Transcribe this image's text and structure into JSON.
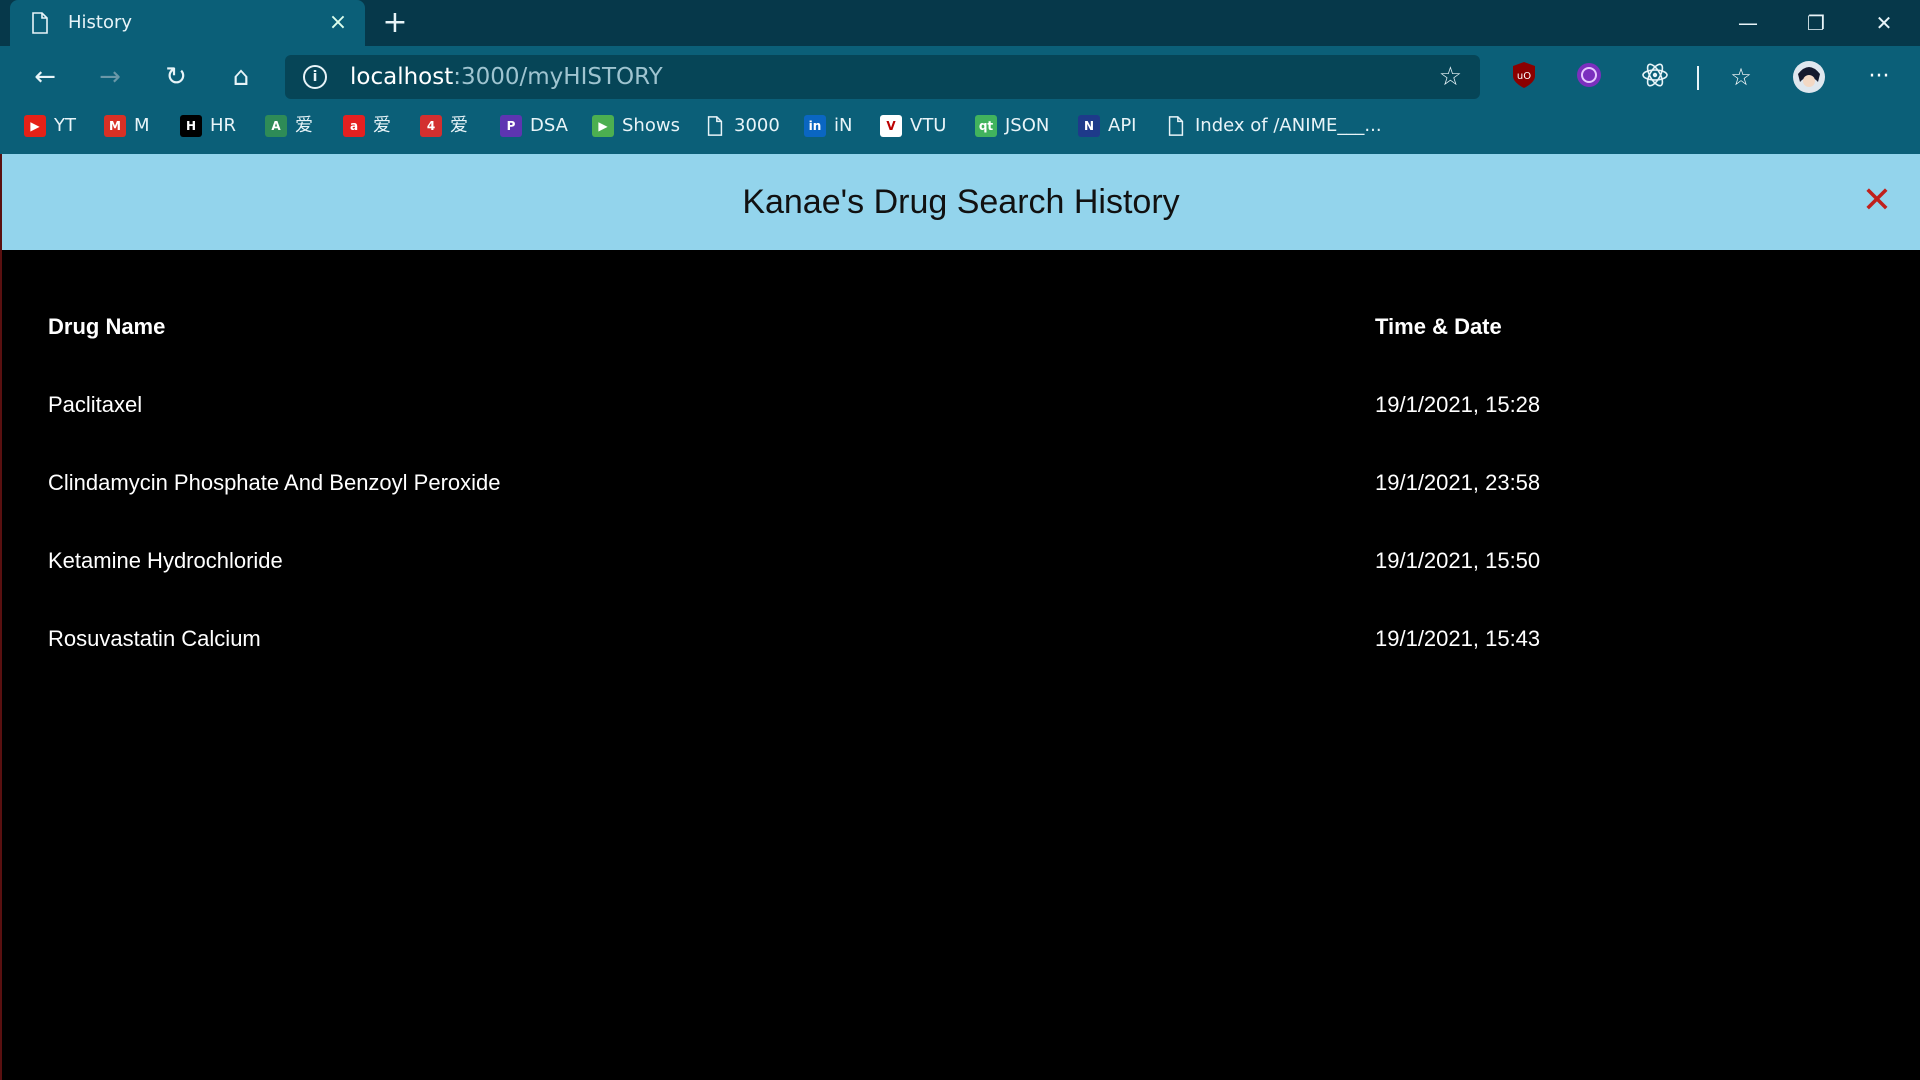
{
  "browser": {
    "tab_title": "History",
    "url_host": "localhost",
    "url_path": ":3000/myHISTORY",
    "bookmarks": [
      {
        "label": "YT",
        "icon": "youtube-icon",
        "color": "#e62117",
        "glyph": "▶"
      },
      {
        "label": "M",
        "icon": "gmail-icon",
        "color": "#d93025",
        "glyph": "M"
      },
      {
        "label": "HR",
        "icon": "hackerrank-icon",
        "color": "#000000",
        "glyph": "H"
      },
      {
        "label": "爱",
        "icon": "anime-a-icon",
        "color": "#2e8b57",
        "glyph": "A"
      },
      {
        "label": "爱",
        "icon": "anime-red-a-icon",
        "color": "#e52020",
        "glyph": "a"
      },
      {
        "label": "爱",
        "icon": "anime-shield-icon",
        "color": "#d32f2f",
        "glyph": "4"
      },
      {
        "label": "DSA",
        "icon": "dsa-icon",
        "color": "#5e35b1",
        "glyph": "P"
      },
      {
        "label": "Shows",
        "icon": "play-icon",
        "color": "#4caf50",
        "glyph": "▶"
      },
      {
        "label": "3000",
        "icon": "page-icon",
        "color": "transparent",
        "glyph": ""
      },
      {
        "label": "iN",
        "icon": "linkedin-icon",
        "color": "#0a66c2",
        "glyph": "in"
      },
      {
        "label": "VTU",
        "icon": "vtu-icon",
        "color": "#ffffff",
        "glyph": "V"
      },
      {
        "label": "JSON",
        "icon": "qt-icon",
        "color": "#41b35d",
        "glyph": "qt"
      },
      {
        "label": "API",
        "icon": "nasa-icon",
        "color": "#1e3a8a",
        "glyph": "N"
      },
      {
        "label": "Index of /ANIME___...",
        "icon": "page-icon",
        "color": "transparent",
        "glyph": ""
      }
    ]
  },
  "app": {
    "title": "Kanae's Drug Search History",
    "close_glyph": "✕"
  },
  "table": {
    "headers": [
      "Drug Name",
      "Time & Date"
    ],
    "rows": [
      [
        "Paclitaxel",
        "19/1/2021, 15:28"
      ],
      [
        "Clindamycin Phosphate And Benzoyl Peroxide",
        "19/1/2021, 23:58"
      ],
      [
        "Ketamine Hydrochloride",
        "19/1/2021, 15:50"
      ],
      [
        "Rosuvastatin Calcium",
        "19/1/2021, 15:43"
      ]
    ]
  }
}
